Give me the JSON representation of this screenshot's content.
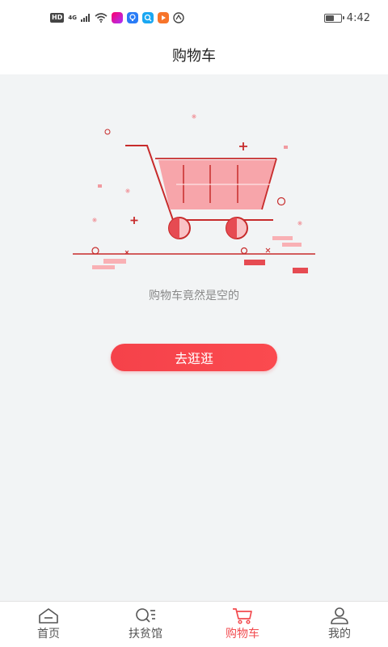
{
  "status_bar": {
    "hd": "HD",
    "network": "4G",
    "time": "4:42",
    "battery_level": 0.55
  },
  "header": {
    "title": "购物车"
  },
  "empty_state": {
    "message": "购物车竟然是空的",
    "button_label": "去逛逛"
  },
  "tabbar": {
    "active_index": 2,
    "accent_color": "#f24b4f",
    "tabs": [
      {
        "label": "首页",
        "icon": "home-icon"
      },
      {
        "label": "扶贫馆",
        "icon": "search-list-icon"
      },
      {
        "label": "购物车",
        "icon": "cart-icon"
      },
      {
        "label": "我的",
        "icon": "user-icon"
      }
    ]
  }
}
